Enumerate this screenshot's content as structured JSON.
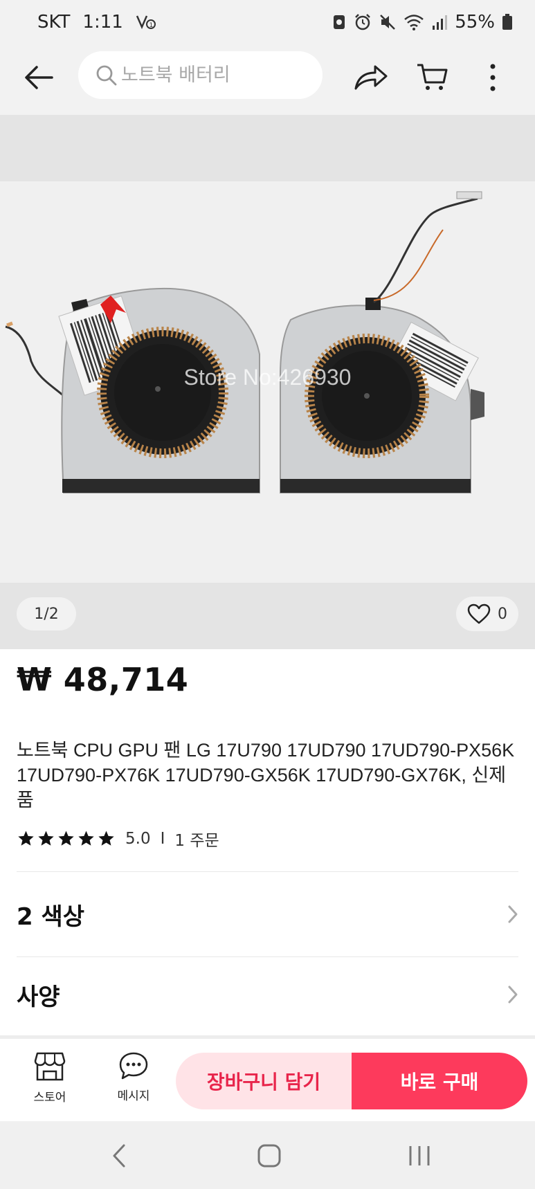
{
  "status_bar": {
    "carrier": "SKT",
    "time": "1:11",
    "battery": "55%"
  },
  "header": {
    "search_placeholder": "노트북 배터리"
  },
  "gallery": {
    "watermark": "Store No:426930",
    "page_indicator": "1/2",
    "like_count": "0"
  },
  "product": {
    "price": "₩ 48,714",
    "title": "노트북 CPU GPU 팬 LG 17U790 17UD790 17UD790-PX56K 17UD790-PX76K 17UD790-GX56K 17UD790-GX76K, 신제품",
    "rating": "5.0",
    "rating_stars": 5,
    "orders": "1 주문"
  },
  "options": {
    "colors_label": "2 색상",
    "spec_label": "사양"
  },
  "action_bar": {
    "store_label": "스토어",
    "message_label": "메시지",
    "add_to_cart": "장바구니 담기",
    "buy_now": "바로 구매"
  },
  "colors": {
    "accent": "#fd3a5c",
    "accent_soft": "#ffe3e7",
    "accent_text": "#e8254b"
  }
}
